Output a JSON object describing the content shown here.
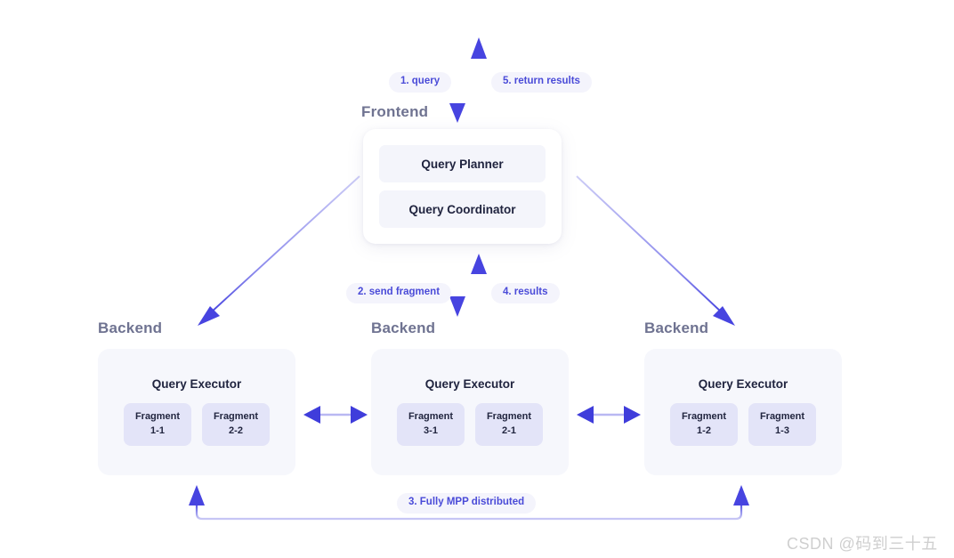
{
  "diagram": {
    "title_frontend": "Frontend",
    "frontend": {
      "rows": [
        {
          "label": "Query Planner"
        },
        {
          "label": "Query Coordinator"
        }
      ]
    },
    "backends": [
      {
        "tier_label": "Backend",
        "executor_label": "Query Executor",
        "fragments": [
          {
            "name": "Fragment",
            "id": "1-1"
          },
          {
            "name": "Fragment",
            "id": "2-2"
          }
        ]
      },
      {
        "tier_label": "Backend",
        "executor_label": "Query Executor",
        "fragments": [
          {
            "name": "Fragment",
            "id": "3-1"
          },
          {
            "name": "Fragment",
            "id": "2-1"
          }
        ]
      },
      {
        "tier_label": "Backend",
        "executor_label": "Query Executor",
        "fragments": [
          {
            "name": "Fragment",
            "id": "1-2"
          },
          {
            "name": "Fragment",
            "id": "1-3"
          }
        ]
      }
    ],
    "flow_labels": {
      "step1": "1. query",
      "step2": "2. send fragment",
      "step3": "3. Fully MPP distributed",
      "step4": "4. results",
      "step5": "5. return results"
    },
    "colors": {
      "arrow_blue": "#4744e0",
      "arrow_light": "#b9b8f2",
      "pill_bg": "#f4f4fc",
      "pill_text": "#4a4bd8",
      "card_bg": "#f6f7fc",
      "fragment_bg": "#e3e4f8",
      "tier_title": "#6f7391",
      "text_dark": "#20243f",
      "watermark": "#cfcfcf"
    }
  },
  "watermark": {
    "text": "CSDN @码到三十五"
  }
}
